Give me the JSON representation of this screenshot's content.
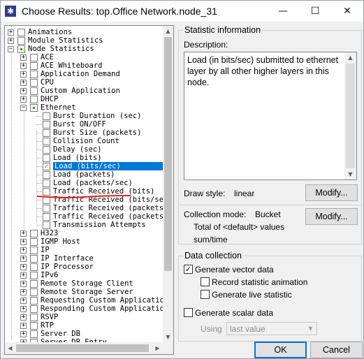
{
  "window": {
    "title": "Choose Results: top.Office Network.node_31",
    "app_icon": "star-icon",
    "minimize_glyph": "—",
    "maximize_glyph": "☐",
    "close_glyph": "✕"
  },
  "tree": {
    "rows": [
      {
        "label": "Animations"
      },
      {
        "label": "Module Statistics"
      },
      {
        "label": "Node Statistics"
      },
      {
        "label": "ACE"
      },
      {
        "label": "ACE Whiteboard"
      },
      {
        "label": "Application Demand"
      },
      {
        "label": "CPU"
      },
      {
        "label": "Custom Application"
      },
      {
        "label": "DHCP"
      },
      {
        "label": "Ethernet"
      },
      {
        "label": "Burst Duration (sec)"
      },
      {
        "label": "Burst ON/OFF"
      },
      {
        "label": "Burst Size (packets)"
      },
      {
        "label": "Collision Count"
      },
      {
        "label": "Delay (sec)"
      },
      {
        "label": "Load (bits)"
      },
      {
        "label": "Load (bits/sec)",
        "selected": true,
        "checked": true
      },
      {
        "label": "Load (packets)"
      },
      {
        "label": "Load (packets/sec)"
      },
      {
        "label": "Traffic Received (bits)"
      },
      {
        "label": "Traffic Received (bits/sec)"
      },
      {
        "label": "Traffic Received (packets)"
      },
      {
        "label": "Traffic Received (packets/sec)"
      },
      {
        "label": "Transmission Attempts"
      },
      {
        "label": "H323"
      },
      {
        "label": "IGMP Host"
      },
      {
        "label": "IP"
      },
      {
        "label": "IP Interface"
      },
      {
        "label": "IP Processor"
      },
      {
        "label": "IPv6"
      },
      {
        "label": "Remote Storage Client"
      },
      {
        "label": "Remote Storage Server"
      },
      {
        "label": "Requesting Custom Application"
      },
      {
        "label": "Responding Custom Application"
      },
      {
        "label": "RSVP"
      },
      {
        "label": "RTP"
      },
      {
        "label": "Server DB"
      },
      {
        "label": "Server DB Entry"
      }
    ],
    "expander_plus": "+",
    "expander_minus": "−",
    "check_glyph": "✓"
  },
  "statistic_info": {
    "legend": "Statistic information",
    "description_label": "Description:",
    "description_text": "Load (in bits/sec) submitted to ethernet layer by all other higher layers in this node.",
    "draw_style_label": "Draw style:",
    "draw_style_value": "linear",
    "modify_label": "Modify...",
    "collection_mode_label": "Collection mode:",
    "collection_mode_value": "Bucket",
    "collection_detail_line1": "Total of <default> values",
    "collection_detail_line2": "sum/time",
    "modify2_label": "Modify..."
  },
  "data_collection": {
    "legend": "Data collection",
    "vector_label": "Generate vector data",
    "vector_checked": true,
    "record_animation_label": "Record statistic animation",
    "live_statistic_label": "Generate live statistic",
    "scalar_label": "Generate scalar data",
    "using_label": "Using",
    "using_value": "last value"
  },
  "footer": {
    "ok_label": "OK",
    "cancel_label": "Cancel"
  },
  "colors": {
    "selection": "#0078d7",
    "check": "#2a9a2a",
    "annotation": "#e02020"
  }
}
